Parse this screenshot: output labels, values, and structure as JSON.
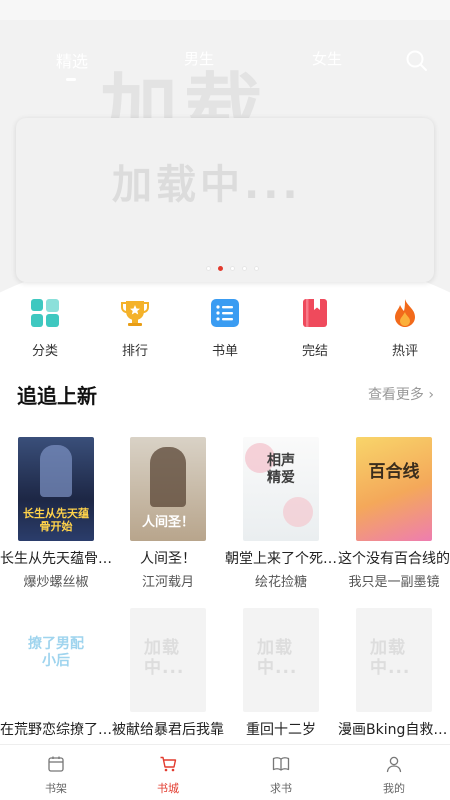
{
  "top_tabs": [
    {
      "label": "精选",
      "active": true
    },
    {
      "label": "男生",
      "active": false
    },
    {
      "label": "女生",
      "active": false
    }
  ],
  "hero": {
    "watermark": "加载"
  },
  "banner": {
    "placeholder_text": "加载中...",
    "slide_count": 5,
    "active_slide": 2
  },
  "quick_menu": [
    {
      "label": "分类",
      "icon": "category-icon",
      "color": "#3ec8c0"
    },
    {
      "label": "排行",
      "icon": "trophy-icon",
      "color": "#f4b22a"
    },
    {
      "label": "书单",
      "icon": "booklist-icon",
      "color": "#3a9cf2"
    },
    {
      "label": "完结",
      "icon": "finished-book-icon",
      "color": "#ef4a5c"
    },
    {
      "label": "热评",
      "icon": "flame-icon",
      "color": "#f26a1b"
    }
  ],
  "section": {
    "title": "追追上新",
    "more_label": "查看更多 ›"
  },
  "books": [
    {
      "title": "长生从先天蕴骨开始",
      "author": "爆炒螺丝椒",
      "cover_text": "长生从先天蕴骨开始"
    },
    {
      "title": "人间圣！",
      "author": "江河载月",
      "cover_text": "人间圣！"
    },
    {
      "title": "朝堂上来了个死对头",
      "author": "绘花捡糖",
      "cover_text": "相声精爱"
    },
    {
      "title": "这个没有百合线的",
      "author": "我只是一副墨镜",
      "cover_text": "百合线"
    },
    {
      "title": "在荒野恋综撩了个小后",
      "author": "",
      "cover_text": "撩了男配小后"
    },
    {
      "title": "被献给暴君后我靠",
      "author": "",
      "cover_text": "加载中..."
    },
    {
      "title": "重回十二岁",
      "author": "",
      "cover_text": "加载中..."
    },
    {
      "title": "漫画Bking自救指南",
      "author": "",
      "cover_text": "加载中..."
    }
  ],
  "bottom_nav": [
    {
      "label": "书架",
      "icon": "bookshelf-icon",
      "active": false
    },
    {
      "label": "书城",
      "icon": "cart-icon",
      "active": true
    },
    {
      "label": "求书",
      "icon": "open-book-icon",
      "active": false
    },
    {
      "label": "我的",
      "icon": "user-icon",
      "active": false
    }
  ],
  "colors": {
    "accent": "#e23b2e",
    "muted": "#999999"
  }
}
